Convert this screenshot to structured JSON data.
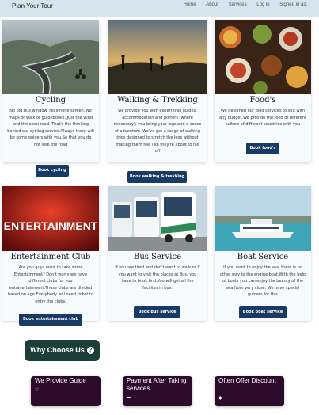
{
  "nav": {
    "brand": "Plan Your Tour",
    "links": [
      "Home",
      "About",
      "Services",
      "Log in",
      "Signed in as:"
    ]
  },
  "cards": [
    {
      "title": "Cycling",
      "desc": "No big bus window. No iPhone screen. No maps or walk or guidebooks. Just the wind and the open road. That's the thinking behind our cycling service.Always there will be some guiders with you.So that you do not lose the road",
      "button": "Book cycling"
    },
    {
      "title": "Walking & Trekking",
      "desc": "we provide you with expert trail guides, accommodation and porters (where necessary); you bring your legs and a sense of adventure. We've got a range of walking trips designed to stretch the legs without making them feel like they're about to fall off",
      "button": "Book walking & trekking"
    },
    {
      "title": "Food's",
      "desc": "We designed our food services to suit with any budget.We provide the food of different culture of different countries with you",
      "button": "Book food's"
    },
    {
      "title": "Entertainment Club",
      "desc": "Are you guys want to take some Entertainment? Don't worry we have different clubs for you entainertainment.Those clubs are divided based on age.Everybody will need ticket to entry the clubs.",
      "button": "Book entertainment club",
      "image_text": "ENTERTAINMENT"
    },
    {
      "title": "Bus Service",
      "desc": "If you are tired and don't want to walk or If you want to visit the places at Bus, you have to book first.You will get all the facilites in bus.",
      "button": "Book bus service"
    },
    {
      "title": "Boat Service",
      "desc": "If you want to enjoy the sea, there is no other way to the engine boat.With the help of boats you can enjoy the beauty of the sea from very close. We have special guiders for this",
      "button": "Book boat service"
    }
  ],
  "why": {
    "label": "Why Choose Us",
    "icon": "question-circle-icon"
  },
  "features": [
    {
      "title": "We Provide Guide",
      "icon": "heart-icon"
    },
    {
      "title": "Payment After Taking services",
      "icon": "money-icon"
    },
    {
      "title": "Often Offer Discount",
      "icon": "discount-icon"
    }
  ],
  "colors": {
    "nav_bg": "#d6e4ec",
    "button_bg": "#183a63",
    "why_bg": "#1d3f3a",
    "feature_bg": "#2b0a2a"
  }
}
